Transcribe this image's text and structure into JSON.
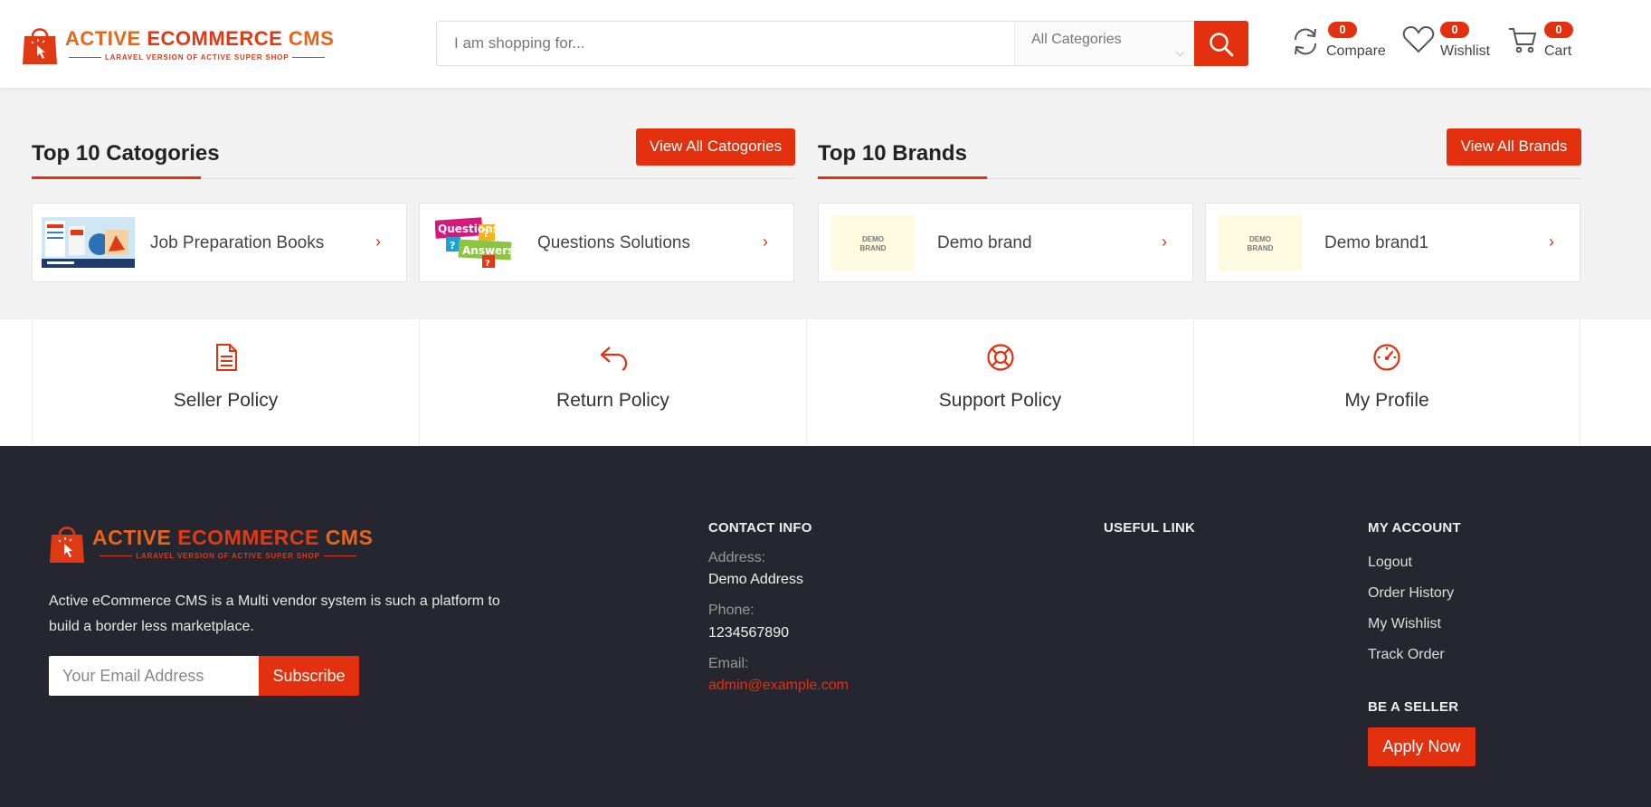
{
  "header": {
    "logo": {
      "word1": "ACTIVE",
      "word2": "ECOMMERCE",
      "word3": "CMS",
      "tagline": "LARAVEL VERSION OF ACTIVE SUPER SHOP"
    },
    "search": {
      "placeholder": "I am shopping for...",
      "category": "All Categories"
    },
    "compare": {
      "count": "0",
      "label": "Compare",
      "icon": "refresh-icon"
    },
    "wishlist": {
      "count": "0",
      "label": "Wishlist",
      "icon": "heart-icon"
    },
    "cart": {
      "count": "0",
      "label": "Cart",
      "icon": "cart-icon"
    }
  },
  "categories": {
    "title": "Top 10 Catogories",
    "view_all": "View All Catogories",
    "items": [
      {
        "label": "Job Preparation Books"
      },
      {
        "label": "Questions Solutions"
      }
    ]
  },
  "brands": {
    "title": "Top 10 Brands",
    "view_all": "View All Brands",
    "items": [
      {
        "label": "Demo brand",
        "logo_text": "DEMO BRAND"
      },
      {
        "label": "Demo brand1",
        "logo_text": "DEMO BRAND"
      }
    ]
  },
  "policies": [
    {
      "label": "Seller Policy",
      "icon": "document-icon"
    },
    {
      "label": "Return Policy",
      "icon": "reply-icon"
    },
    {
      "label": "Support Policy",
      "icon": "lifebuoy-icon"
    },
    {
      "label": "My Profile",
      "icon": "dashboard-icon"
    }
  ],
  "footer": {
    "description": "Active eCommerce CMS is a Multi vendor system is such a platform to build a border less marketplace.",
    "subscribe": {
      "placeholder": "Your Email Address",
      "button": "Subscribe"
    },
    "contact": {
      "title": "CONTACT INFO",
      "address_label": "Address:",
      "address": "Demo Address",
      "phone_label": "Phone:",
      "phone": "1234567890",
      "email_label": "Email:",
      "email": "admin@example.com"
    },
    "useful": {
      "title": "USEFUL LINK"
    },
    "account": {
      "title": "MY ACCOUNT",
      "links": [
        "Logout",
        "Order History",
        "My Wishlist",
        "Track Order"
      ]
    },
    "seller": {
      "title": "BE A SELLER",
      "button": "Apply Now"
    }
  },
  "colors": {
    "accent": "#e3300f",
    "logo_orange": "#e8651a",
    "footer_bg": "#262630"
  }
}
